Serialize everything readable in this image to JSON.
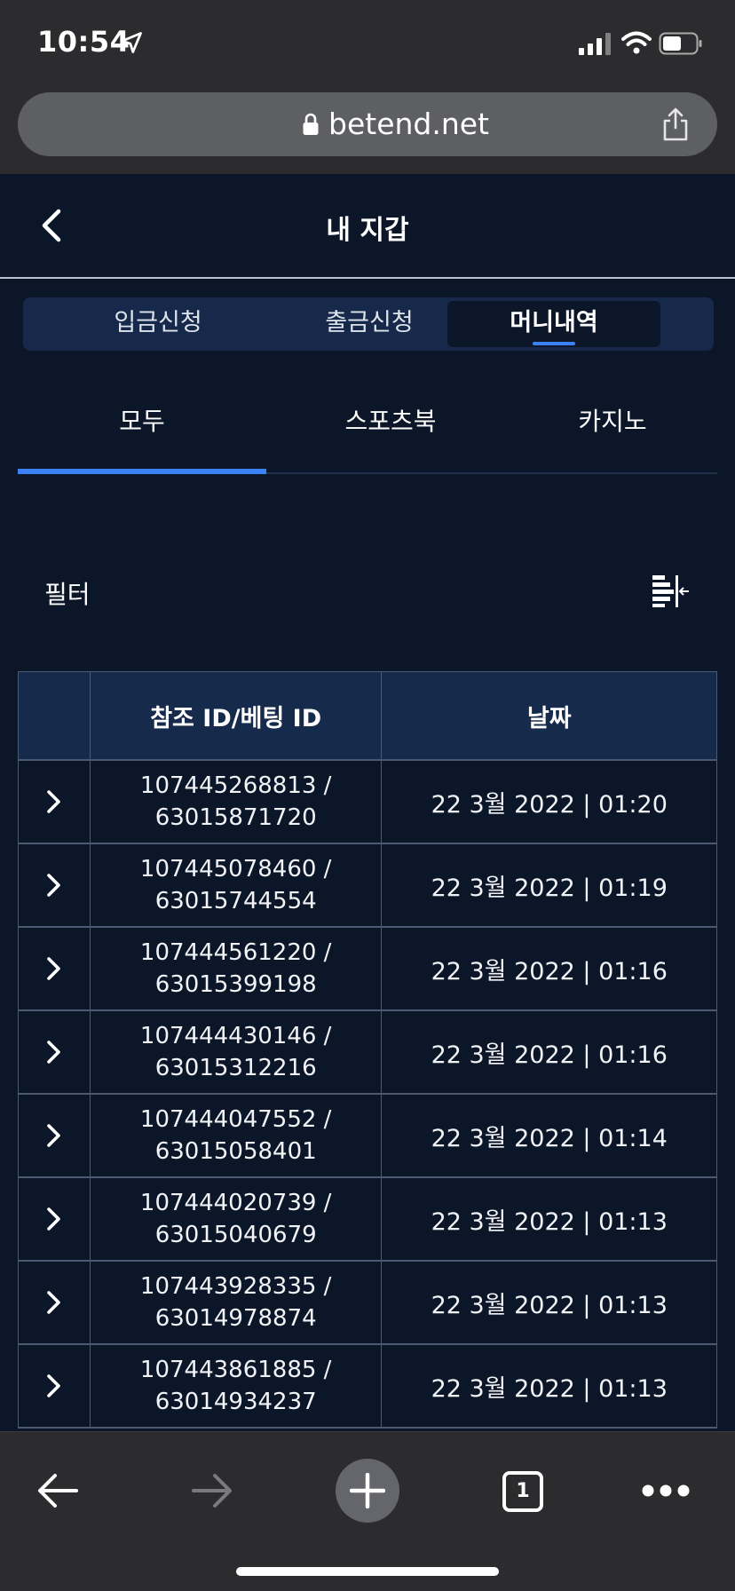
{
  "status_bar": {
    "time": "10:54"
  },
  "browser": {
    "url": "betend.net",
    "tab_count": "1"
  },
  "header": {
    "title": "내 지갑"
  },
  "segments": [
    {
      "label": "입금신청",
      "active": false
    },
    {
      "label": "출금신청",
      "active": false
    },
    {
      "label": "머니내역",
      "active": true
    }
  ],
  "sub_tabs": [
    {
      "label": "모두",
      "active": true
    },
    {
      "label": "스포츠북",
      "active": false
    },
    {
      "label": "카지노",
      "active": false
    }
  ],
  "filter": {
    "label": "필터"
  },
  "table": {
    "headers": [
      "",
      "참조 ID/베팅 ID",
      "날짜"
    ],
    "rows": [
      {
        "ref": "107445268813 /\n63015871720",
        "date": "22 3월 2022 | 01:20"
      },
      {
        "ref": "107445078460 /\n63015744554",
        "date": "22 3월 2022 | 01:19"
      },
      {
        "ref": "107444561220 /\n63015399198",
        "date": "22 3월 2022 | 01:16"
      },
      {
        "ref": "107444430146 /\n63015312216",
        "date": "22 3월 2022 | 01:16"
      },
      {
        "ref": "107444047552 /\n63015058401",
        "date": "22 3월 2022 | 01:14"
      },
      {
        "ref": "107444020739 /\n63015040679",
        "date": "22 3월 2022 | 01:13"
      },
      {
        "ref": "107443928335 /\n63014978874",
        "date": "22 3월 2022 | 01:13"
      },
      {
        "ref": "107443861885 /\n63014934237",
        "date": "22 3월 2022 | 01:13"
      }
    ]
  },
  "colors": {
    "background": "#0b1628",
    "accent": "#3b82f6",
    "header_row": "#162a4c"
  }
}
